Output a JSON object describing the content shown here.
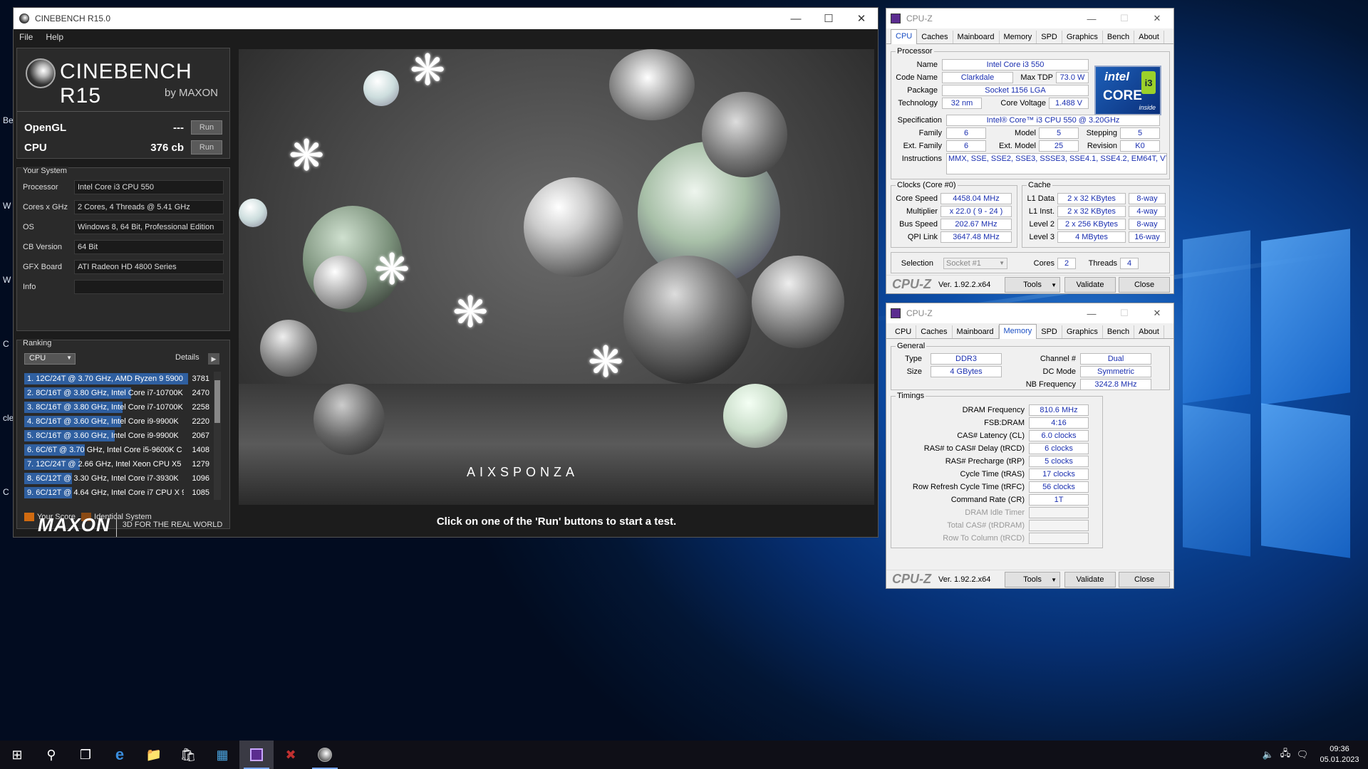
{
  "desktop": {
    "partial_icon_labels": [
      "Be",
      "W",
      "W",
      "C",
      "cle",
      "C"
    ]
  },
  "cinebench": {
    "title": "CINEBENCH R15.0",
    "menu": [
      "File",
      "Help"
    ],
    "logo_text": "CINEBENCH R15",
    "logo_by": "by MAXON",
    "tests": [
      {
        "label": "OpenGL",
        "value": "---",
        "button": "Run"
      },
      {
        "label": "CPU",
        "value": "376 cb",
        "button": "Run"
      }
    ],
    "your_system": {
      "title": "Your System",
      "rows": [
        {
          "key": "Processor",
          "value": "Intel Core i3 CPU 550"
        },
        {
          "key": "Cores x GHz",
          "value": "2 Cores, 4 Threads @ 5.41 GHz"
        },
        {
          "key": "OS",
          "value": "Windows 8, 64 Bit, Professional Edition"
        },
        {
          "key": "CB Version",
          "value": "64 Bit"
        },
        {
          "key": "GFX Board",
          "value": "ATI Radeon HD 4800 Series"
        },
        {
          "key": "Info",
          "value": ""
        }
      ]
    },
    "ranking": {
      "title": "Ranking",
      "select": "CPU",
      "details": "Details",
      "items": [
        {
          "text": "1. 12C/24T @ 3.70 GHz, AMD Ryzen 9 5900",
          "score": "3781",
          "fraction": 1.0
        },
        {
          "text": "2. 8C/16T @ 3.80 GHz, Intel Core i7-10700K",
          "score": "2470",
          "fraction": 0.65
        },
        {
          "text": "3. 8C/16T @ 3.80 GHz, Intel Core i7-10700K",
          "score": "2258",
          "fraction": 0.6
        },
        {
          "text": "4. 8C/16T @ 3.60 GHz, Intel Core i9-9900K",
          "score": "2220",
          "fraction": 0.59
        },
        {
          "text": "5. 8C/16T @ 3.60 GHz, Intel Core i9-9900K",
          "score": "2067",
          "fraction": 0.55
        },
        {
          "text": "6. 6C/6T @ 3.70 GHz, Intel Core i5-9600K C",
          "score": "1408",
          "fraction": 0.37
        },
        {
          "text": "7. 12C/24T @ 2.66 GHz, Intel Xeon CPU X5",
          "score": "1279",
          "fraction": 0.34
        },
        {
          "text": "8. 6C/12T @ 3.30 GHz,  Intel Core i7-3930K",
          "score": "1096",
          "fraction": 0.29
        },
        {
          "text": "9. 6C/12T @ 4.64 GHz, Intel Core i7 CPU X 9",
          "score": "1085",
          "fraction": 0.29
        }
      ],
      "legend": [
        {
          "label": "Your Score",
          "color": "#d06a10"
        },
        {
          "label": "Identical System",
          "color": "#8a4a14"
        }
      ]
    },
    "footer_brand": "MAXON",
    "footer_tag": "3D FOR THE REAL WORLD",
    "render_logo": "AIXSPONZA",
    "status": "Click on one of the 'Run' buttons to start a test."
  },
  "cpuz1": {
    "title": "CPU-Z",
    "tabs": [
      "CPU",
      "Caches",
      "Mainboard",
      "Memory",
      "SPD",
      "Graphics",
      "Bench",
      "About"
    ],
    "active_tab": "CPU",
    "processor_label": "Processor",
    "name_k": "Name",
    "name": "Intel Core i3 550",
    "codename_k": "Code Name",
    "codename": "Clarkdale",
    "maxtdp_k": "Max TDP",
    "maxtdp": "73.0 W",
    "package_k": "Package",
    "package": "Socket 1156 LGA",
    "tech_k": "Technology",
    "tech": "32 nm",
    "cv_k": "Core Voltage",
    "cv": "1.488 V",
    "spec_k": "Specification",
    "spec": "Intel® Core™ i3 CPU       550  @ 3.20GHz",
    "family_k": "Family",
    "family": "6",
    "model_k": "Model",
    "model": "5",
    "stepping_k": "Stepping",
    "stepping": "5",
    "extfam_k": "Ext. Family",
    "extfam": "6",
    "extmod_k": "Ext. Model",
    "extmod": "25",
    "rev_k": "Revision",
    "rev": "K0",
    "instr_k": "Instructions",
    "instr": "MMX, SSE, SSE2, SSE3, SSSE3, SSE4.1, SSE4.2, EM64T, VT-x",
    "clocks_label": "Clocks (Core #0)",
    "corespeed_k": "Core Speed",
    "corespeed": "4458.04 MHz",
    "mult_k": "Multiplier",
    "mult": "x 22.0 ( 9 - 24 )",
    "bus_k": "Bus Speed",
    "bus": "202.67 MHz",
    "qpi_k": "QPI Link",
    "qpi": "3647.48 MHz",
    "cache_label": "Cache",
    "l1d_k": "L1 Data",
    "l1d": "2 x 32 KBytes",
    "l1d_w": "8-way",
    "l1i_k": "L1 Inst.",
    "l1i": "2 x 32 KBytes",
    "l1i_w": "4-way",
    "l2_k": "Level 2",
    "l2": "2 x 256 KBytes",
    "l2_w": "8-way",
    "l3_k": "Level 3",
    "l3": "4 MBytes",
    "l3_w": "16-way",
    "selection_k": "Selection",
    "selection": "Socket #1",
    "cores_k": "Cores",
    "cores": "2",
    "threads_k": "Threads",
    "threads": "4",
    "brand": "CPU-Z",
    "version": "Ver. 1.92.2.x64",
    "tools": "Tools",
    "validate": "Validate",
    "close": "Close",
    "intel_logo": {
      "brand": "intel",
      "line": "CORE",
      "badge": "i3",
      "tag": "inside"
    }
  },
  "cpuz2": {
    "title": "CPU-Z",
    "tabs": [
      "CPU",
      "Caches",
      "Mainboard",
      "Memory",
      "SPD",
      "Graphics",
      "Bench",
      "About"
    ],
    "active_tab": "Memory",
    "general_label": "General",
    "type_k": "Type",
    "type": "DDR3",
    "channel_k": "Channel #",
    "channel": "Dual",
    "size_k": "Size",
    "size": "4 GBytes",
    "dc_k": "DC Mode",
    "dc": "Symmetric",
    "nbf_k": "NB Frequency",
    "nbf": "3242.8 MHz",
    "timings_label": "Timings",
    "timings": [
      {
        "k": "DRAM Frequency",
        "v": "810.6 MHz"
      },
      {
        "k": "FSB:DRAM",
        "v": "4:16"
      },
      {
        "k": "CAS# Latency (CL)",
        "v": "6.0 clocks"
      },
      {
        "k": "RAS# to CAS# Delay (tRCD)",
        "v": "6 clocks"
      },
      {
        "k": "RAS# Precharge (tRP)",
        "v": "5 clocks"
      },
      {
        "k": "Cycle Time (tRAS)",
        "v": "17 clocks"
      },
      {
        "k": "Row Refresh Cycle Time (tRFC)",
        "v": "56 clocks"
      },
      {
        "k": "Command Rate (CR)",
        "v": "1T"
      },
      {
        "k": "DRAM Idle Timer",
        "v": ""
      },
      {
        "k": "Total CAS# (tRDRAM)",
        "v": ""
      },
      {
        "k": "Row To Column (tRCD)",
        "v": ""
      }
    ],
    "brand": "CPU-Z",
    "version": "Ver. 1.92.2.x64",
    "tools": "Tools",
    "validate": "Validate",
    "close": "Close"
  },
  "taskbar": {
    "time": "09:36",
    "date": "05.01.2023"
  }
}
